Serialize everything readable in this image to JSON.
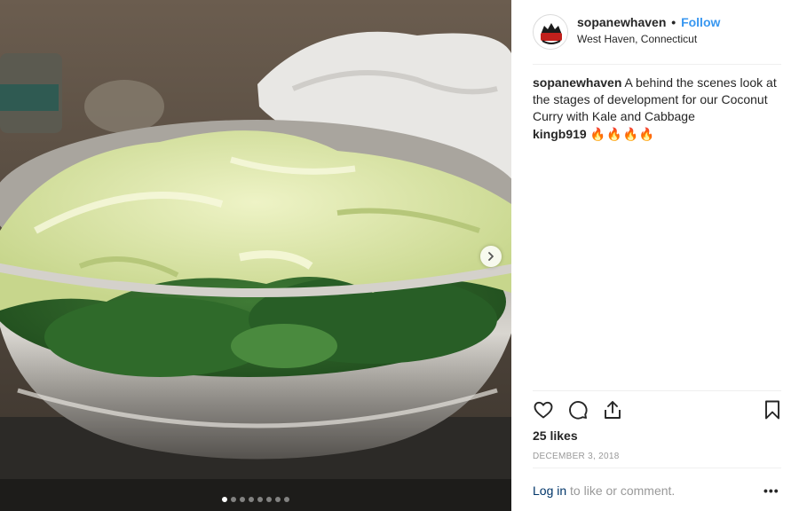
{
  "post": {
    "photo": {
      "alt_icon": "photo-of-cabbage-and-kale-in-steel-bowl",
      "next_icon": "chevron-right-icon",
      "carousel_count": 8,
      "carousel_active": 1
    },
    "header": {
      "username": "sopanewhaven",
      "separator": "•",
      "follow_label": "Follow",
      "location": "West Haven, Connecticut"
    },
    "caption": {
      "username": "sopanewhaven",
      "text": "A behind the scenes look at the stages of development for our Coconut Curry with Kale and Cabbage"
    },
    "comments": [
      {
        "username": "kingb919",
        "text": "🔥🔥🔥🔥"
      }
    ],
    "actions": {
      "like_icon": "heart-icon",
      "comment_icon": "comment-icon",
      "share_icon": "share-icon",
      "save_icon": "bookmark-icon"
    },
    "likes": "25 likes",
    "date": "December 3, 2018",
    "login": {
      "link_label": "Log in",
      "rest_text": " to like or comment.",
      "more_label": "•••"
    },
    "colors": {
      "accent": "#3897f0",
      "text": "#262626",
      "muted": "#999999",
      "link": "#003569"
    }
  }
}
